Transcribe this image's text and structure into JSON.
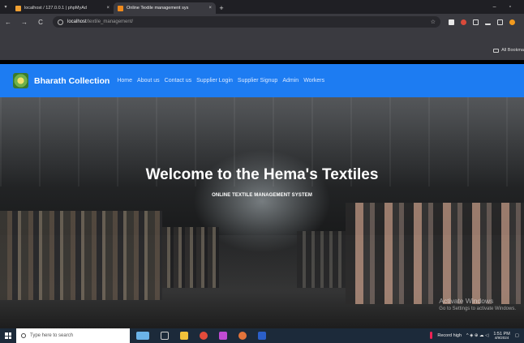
{
  "browser": {
    "tabs": [
      {
        "label": "localhost / 127.0.0.1 | phpMyAd",
        "active": false,
        "favicon_color": "#f0a032"
      },
      {
        "label": "Online Textile management sys",
        "active": true,
        "favicon_color": "#f08a1c"
      }
    ],
    "tab_close_glyph": "×",
    "new_tab_glyph": "+",
    "menu_glyph": "▾",
    "window_controls": {
      "minimize": "–",
      "restore": "▫"
    },
    "nav": {
      "back": "←",
      "forward": "→",
      "reload": "C"
    },
    "url_host": "localhost",
    "url_path": "/textile_management/",
    "star_glyph": "☆",
    "bookmarks_label": "All Bookma"
  },
  "site": {
    "brand": "Bharath Collection",
    "nav_links": [
      "Home",
      "About us",
      "Contact us",
      "Supplier Login",
      "Supplier Signup",
      "Admin",
      "Workers"
    ],
    "hero_title": "Welcome to the Hema's Textiles",
    "hero_subtitle": "ONLINE TEXTILE MANAGEMENT SYSTEM"
  },
  "watermark": {
    "line1": "Activate Windows",
    "line2": "Go to Settings to activate Windows."
  },
  "taskbar": {
    "search_placeholder": "Type here to search",
    "weather": "Record high",
    "time": "1:51 PM",
    "date": "4/9/2024"
  },
  "colors": {
    "navbar": "#1d7cf2",
    "browser_chrome": "#3a3a40",
    "taskbar": "#1c2a3a"
  }
}
